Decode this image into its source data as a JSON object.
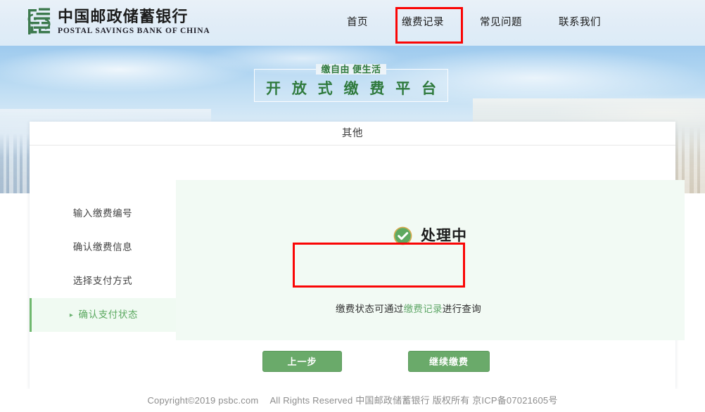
{
  "header": {
    "logo": {
      "icon": "psbc-logo-icon",
      "name_cn": "中国邮政储蓄银行",
      "name_en": "POSTAL SAVINGS BANK OF CHINA",
      "color": "#3d7a4e"
    },
    "nav": [
      {
        "label": "首页",
        "active": false
      },
      {
        "label": "缴费记录",
        "active": false,
        "annotated": true
      },
      {
        "label": "常见问题",
        "active": false
      },
      {
        "label": "联系我们",
        "active": false
      }
    ]
  },
  "banner": {
    "slogan_sub": "缴自由 便生活",
    "slogan_main": "开 放 式 缴 费 平 台",
    "slogan_color": "#2f7a3d"
  },
  "card": {
    "title": "其他",
    "steps": [
      {
        "label": "输入缴费编号",
        "active": false
      },
      {
        "label": "确认缴费信息",
        "active": false
      },
      {
        "label": "选择支付方式",
        "active": false
      },
      {
        "label": "确认支付状态",
        "active": true,
        "marker": "▸"
      }
    ],
    "result": {
      "status_icon": "check-circle-icon",
      "status_icon_color": "#5fa95f",
      "status_text": "处理中",
      "notice_prefix": "缴费状态可通过",
      "notice_link": "缴费记录",
      "notice_suffix": "进行查询",
      "notice_link_color": "#62a86a"
    },
    "buttons": {
      "prev_label": "上一步",
      "next_label": "继续缴费",
      "color": "#6aaa6a"
    }
  },
  "annotations": {
    "color": "#fa0505",
    "nav_box_target": "缴费记录",
    "notice_box_target": "缴费状态可通过缴费记录进行查询"
  },
  "footer": {
    "copyright": "Copyright©2019 psbc.com",
    "rights": "All Rights Reserved 中国邮政储蓄银行 版权所有 京ICP备07021605号"
  }
}
